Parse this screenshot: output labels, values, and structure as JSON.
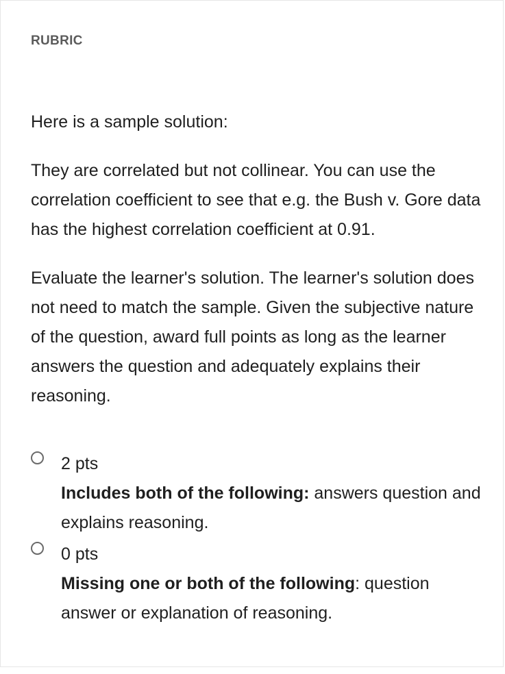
{
  "rubric": {
    "heading": "RUBRIC",
    "intro": "Here is a sample solution:",
    "sample_solution": "They are correlated but not collinear. You can use the correlation coefficient to see that e.g. the Bush v. Gore data has the highest correlation coefficient at 0.91.",
    "instructions": "Evaluate the learner's solution. The learner's solution does not need to match the sample. Given the subjective nature of the question, award full points as long as the learner answers the question and adequately explains their reasoning.",
    "options": [
      {
        "points": "2 pts",
        "criteria_bold": "Includes both of the following:",
        "criteria_text": " answers question and explains reasoning."
      },
      {
        "points": "0 pts",
        "criteria_bold": "Missing one or both of the following",
        "criteria_text": ": question answer or explanation of reasoning."
      }
    ]
  }
}
